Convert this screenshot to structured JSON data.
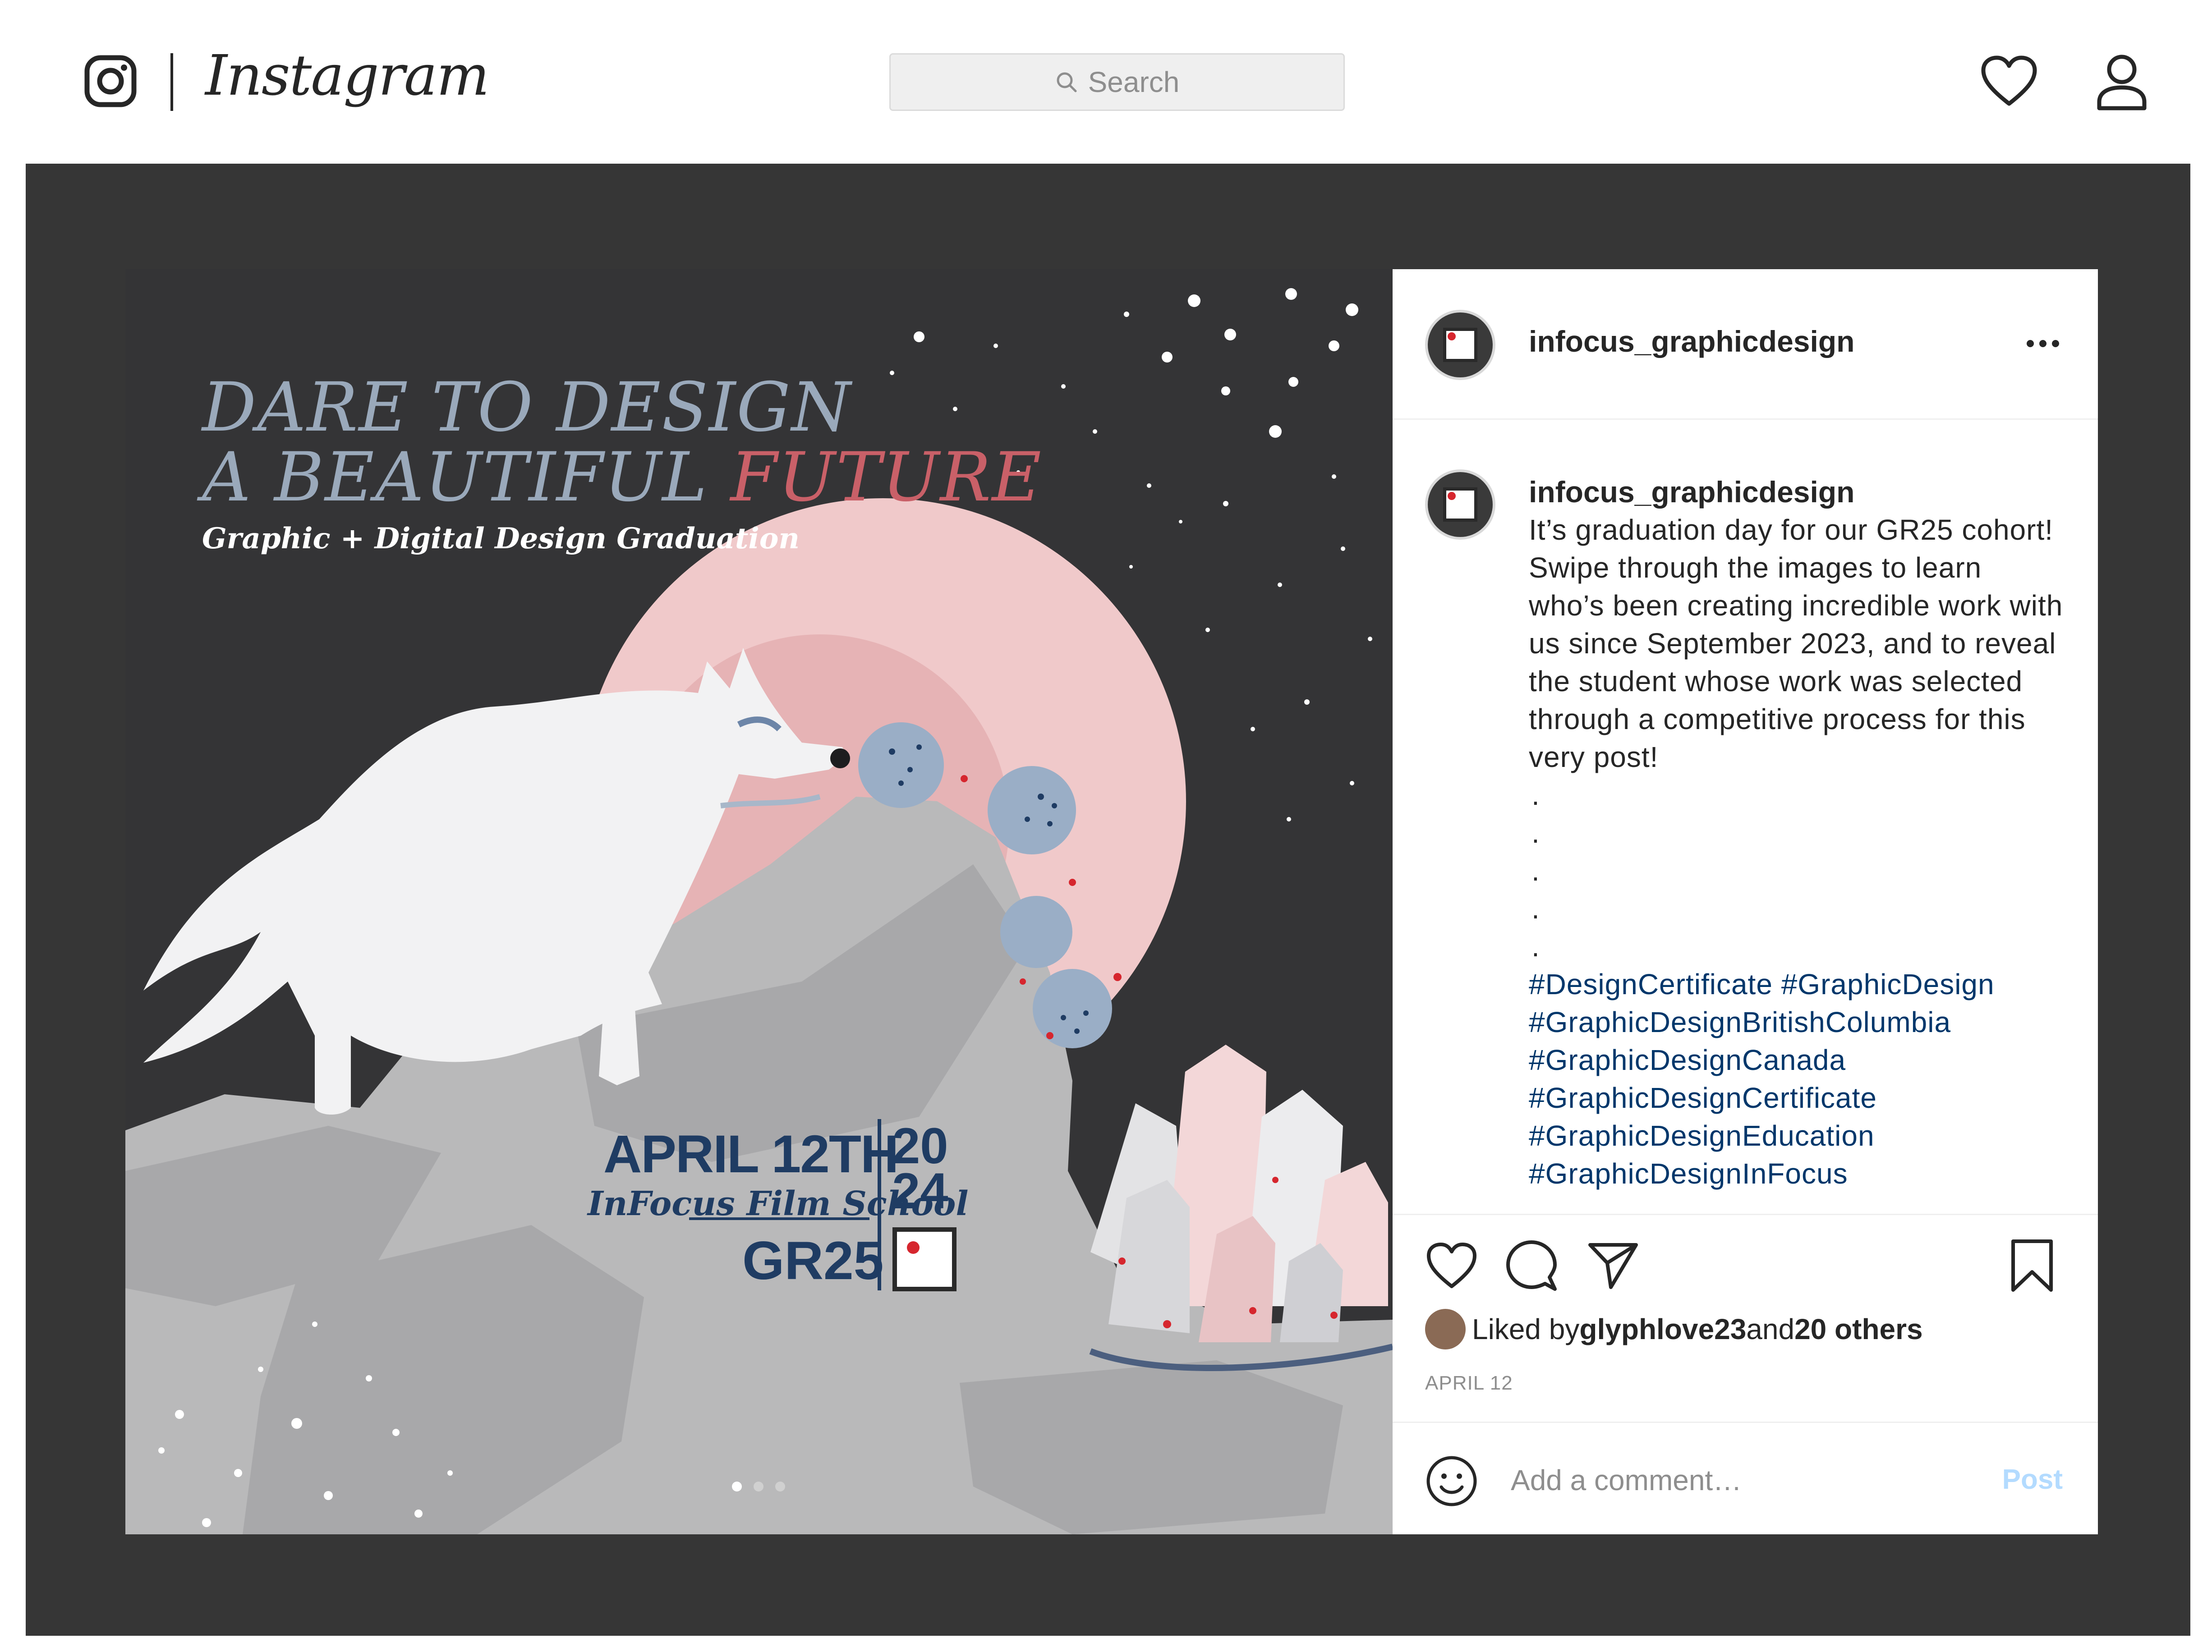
{
  "app": {
    "wordmark": "Instagram"
  },
  "search": {
    "placeholder": "Search"
  },
  "post": {
    "username": "infocus_graphicdesign",
    "artwork": {
      "headline_line1": "DARE TO DESIGN",
      "headline_line2_a": "A BEAUTIFUL ",
      "headline_line2_b": "FUTURE",
      "subtitle": "Graphic + Digital Design Graduation",
      "date": "APRIL 12TH",
      "school": "InFocus Film School",
      "cohort": "GR25",
      "year_top": "20",
      "year_bottom": "24"
    },
    "caption": {
      "username": "infocus_graphicdesign",
      "text": "It’s graduation day for our GR25 cohort! Swipe through the images to learn who’s been creating incredible work with us since September 2023, and to reveal the student whose work was selected through a competitive process for this very post!",
      "dots": [
        ".",
        ".",
        ".",
        ".",
        "."
      ],
      "hashtags": [
        "#DesignCertificate",
        "#GraphicDesign",
        "#GraphicDesignBritishColumbia",
        "#GraphicDesignCanada",
        "#GraphicDesignCertificate",
        "#GraphicDesignEducation",
        "#GraphicDesignInFocus"
      ]
    },
    "likes": {
      "prefix": "Liked by ",
      "user": "glyphlove23",
      "middle": " and ",
      "others": "20 others"
    },
    "date": "APRIL 12",
    "comment": {
      "placeholder": "Add a comment…",
      "post_label": "Post"
    },
    "carousel": {
      "count": 3,
      "active": 1
    }
  },
  "colors": {
    "stage": "#363636",
    "art_bg": "#343436",
    "moon": "#f0c9ca",
    "rock": "#b9b9ba",
    "title_blue": "#9aa9bb",
    "title_red": "#c96068",
    "navy": "#1f3c63",
    "hashtag": "#00376b",
    "post_button": "#b3dbff"
  },
  "icons": [
    "instagram-icon",
    "search-icon",
    "heart-icon",
    "user-icon",
    "more-icon",
    "like-icon",
    "comment-icon",
    "share-icon",
    "save-icon",
    "emoji-icon"
  ]
}
